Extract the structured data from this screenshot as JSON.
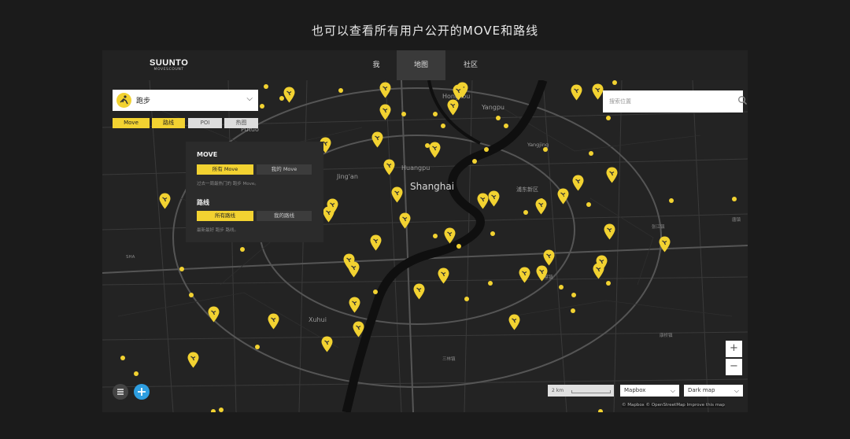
{
  "headline": "也可以查看所有用户公开的MOVE和路线",
  "app": {
    "brand": "SUUNTO",
    "brand_sub": "MOVESCOUNT",
    "tabs": [
      {
        "label": "我",
        "active": false
      },
      {
        "label": "地图",
        "active": true
      },
      {
        "label": "社区",
        "active": false
      }
    ]
  },
  "activity_select": {
    "value": "跑步"
  },
  "filters": [
    {
      "label": "Move",
      "active": true
    },
    {
      "label": "路线",
      "active": true
    },
    {
      "label": "POI",
      "active": false
    },
    {
      "label": "热图",
      "active": false
    }
  ],
  "panel": {
    "move_heading": "MOVE",
    "move_all": "所有 Move",
    "move_mine": "我的 Move",
    "move_note": "过去一周最热门的 跑步 Move。",
    "route_heading": "路线",
    "route_all": "所有路线",
    "route_mine": "我的路线",
    "route_note": "最新最好 跑步 路线。"
  },
  "search": {
    "placeholder": "搜索位置"
  },
  "zoom": {
    "in": "+",
    "out": "−"
  },
  "bottom": {
    "scale_label": "2 km",
    "style_select": "Mapbox",
    "layer_select": "Dark map",
    "attribution": "© Mapbox © OpenStreetMap Improve this map"
  },
  "map_labels": {
    "city": "Shanghai",
    "districts": [
      "Putuo",
      "Hongkou",
      "Yangpu",
      "Jing'an",
      "Huangpu",
      "Xuhui",
      "Yangjing",
      "浦东新区"
    ],
    "minor": [
      "北蔡镇",
      "三林镇",
      "张江镇",
      "唐镇",
      "康桥镇",
      "SHA"
    ]
  },
  "colors": {
    "accent": "#f2d231",
    "background": "#1b1b1b",
    "map": "#232323"
  },
  "icons": [
    "runner-icon",
    "search-icon",
    "menu-icon",
    "plus-icon",
    "chevron-down-icon"
  ]
}
